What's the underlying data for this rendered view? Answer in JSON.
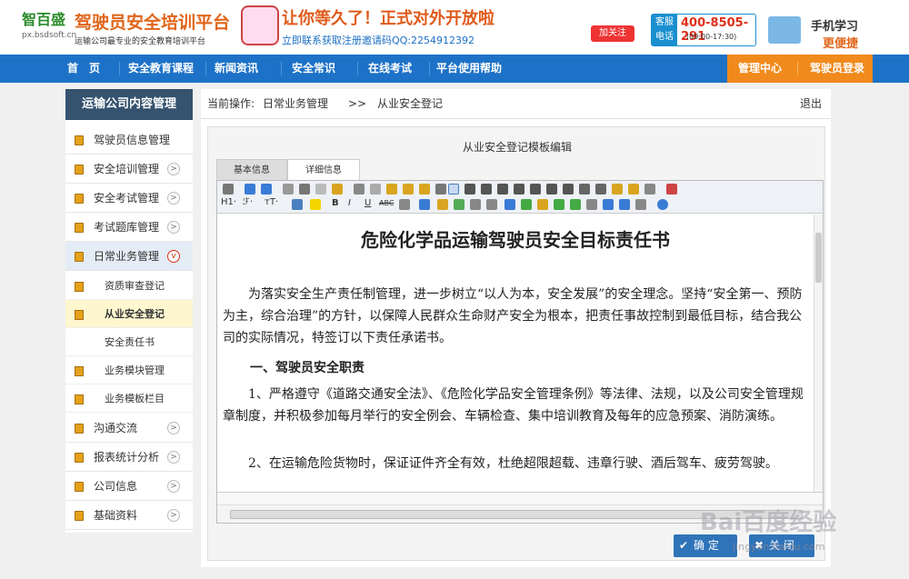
{
  "header": {
    "logo_cn": "智百盛",
    "logo_url": "px.bsdsoft.cn",
    "title": "驾驶员安全培训平台",
    "subtitle": "运输公司最专业的安全教育培训平台",
    "promo_main": "让你等久了！正式对外开放啦",
    "promo_sub": "立即联系获取注册邀请码QQ:2254912392",
    "follow": "加关注",
    "phone_label": "客服电话",
    "phone_number": "400-8505-291",
    "phone_hours": "(09:00-17:30)",
    "mobile_line1": "手机学习",
    "mobile_line2": "更便捷"
  },
  "nav": {
    "items": [
      "首　页",
      "安全教育课程",
      "新闻资讯",
      "安全常识",
      "在线考试",
      "平台使用帮助"
    ],
    "right": [
      "管理中心",
      "驾驶员登录"
    ]
  },
  "sidebar": {
    "title": "运输公司内容管理",
    "items": [
      "驾驶员信息管理",
      "安全培训管理",
      "安全考试管理",
      "考试题库管理",
      "日常业务管理"
    ],
    "sub_items": [
      "资质审查登记",
      "从业安全登记",
      "安全责任书",
      "业务模块管理",
      "业务模板栏目"
    ],
    "items_after": [
      "沟通交流",
      "报表统计分析",
      "公司信息",
      "基础资料"
    ]
  },
  "breadcrumb": {
    "label": "当前操作:",
    "parent": "日常业务管理",
    "sep": ">>",
    "current": "从业安全登记",
    "exit": "退出"
  },
  "panel": {
    "title": "从业安全登记模板编辑",
    "tabs": [
      "基本信息",
      "详细信息"
    ]
  },
  "document": {
    "title": "危险化学品运输驾驶员安全目标责任书",
    "para1": "为落实安全生产责任制管理，进一步树立“以人为本，安全发展”的安全理念。坚持“安全第一、预防为主，综合治理”的方针，以保障人民群众生命财产安全为根本，把责任事故控制到最低目标，结合我公司的实际情况，特签订以下责任承诺书。",
    "heading1": "一、驾驶员安全职责",
    "para2": "1、严格遵守《道路交通安全法》、《危险化学品安全管理条例》等法律、法规，以及公司安全管理规章制度，并积极参加每月举行的安全例会、车辆检查、集中培训教育及每年的应急预案、消防演练。",
    "para3": "2、在运输危险货物时，保证证件齐全有效，杜绝超限超载、违章行驶、酒后驾车、疲劳驾驶。"
  },
  "toolbar": {
    "heading": "H1·",
    "font": "ℱ·",
    "size": "тT·",
    "bold": "B",
    "italic": "I",
    "underline": "U",
    "strike": "ABC"
  },
  "buttons": {
    "ok": "确 定",
    "cancel": "关 闭",
    "ok_mark": "✔",
    "cancel_mark": "✖"
  },
  "watermark": {
    "text": "Bai百度经验",
    "url": "jingyan.baidu.com"
  }
}
